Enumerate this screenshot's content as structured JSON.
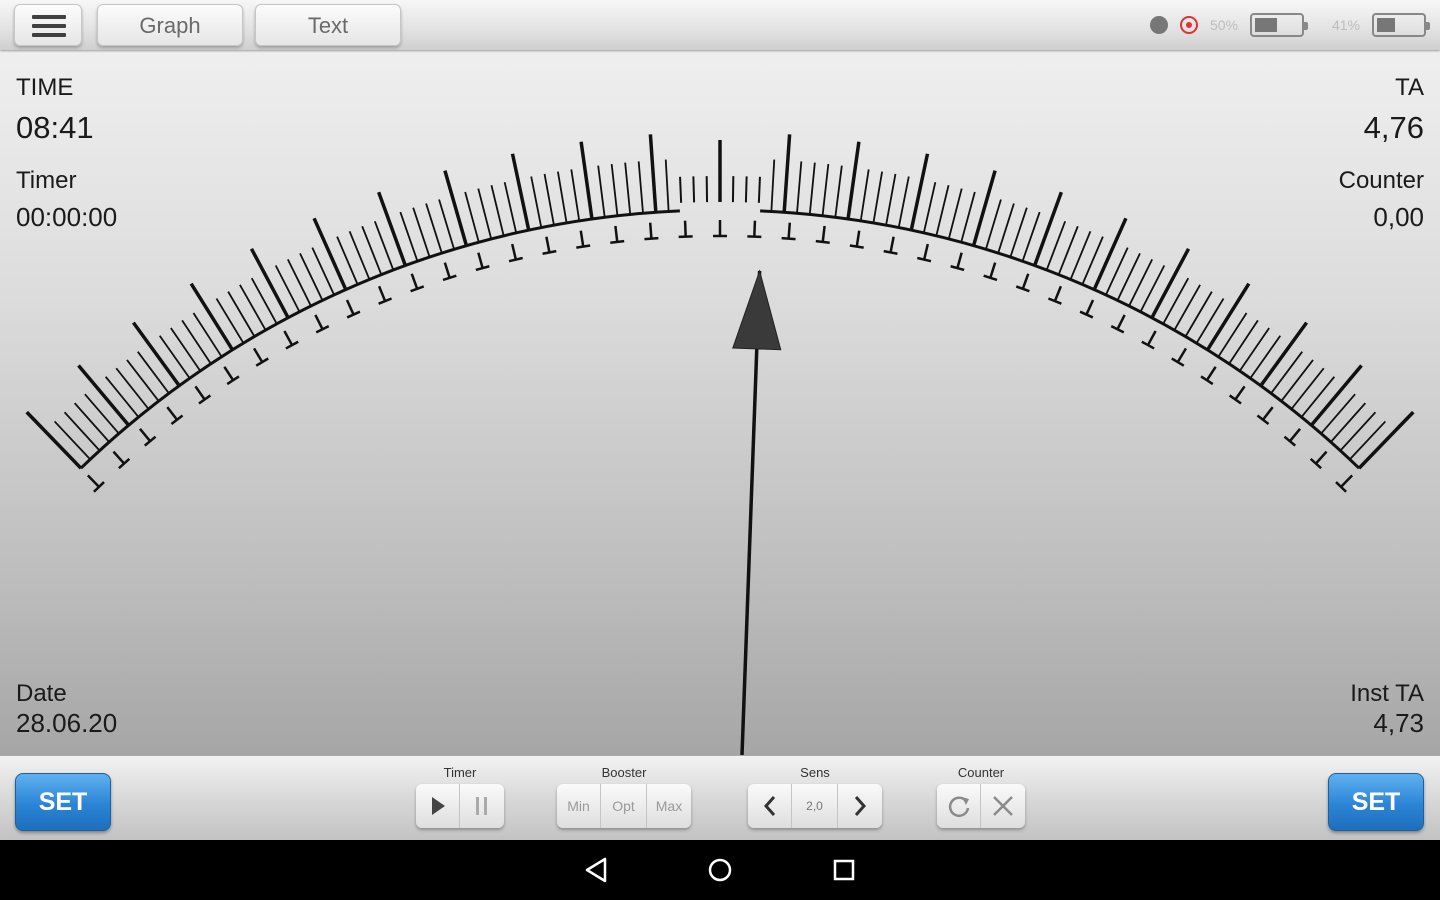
{
  "topbar": {
    "graph_label": "Graph",
    "text_label": "Text",
    "battery1_percent": "50%",
    "battery1_level": 0.5,
    "battery2_percent": "41%",
    "battery2_level": 0.41
  },
  "readouts": {
    "time_label": "TIME",
    "time_value": "08:41",
    "timer_label": "Timer",
    "timer_value": "00:00:00",
    "date_label": "Date",
    "date_value": "28.06.20",
    "ta_label": "TA",
    "ta_value": "4,76",
    "counter_label": "Counter",
    "counter_value": "0,00",
    "inst_ta_label": "Inst TA",
    "inst_ta_value": "4,73"
  },
  "meter": {
    "needle_fraction": 0.53
  },
  "controls": {
    "set_left": "SET",
    "set_right": "SET",
    "timer_title": "Timer",
    "booster_title": "Booster",
    "booster_min": "Min",
    "booster_opt": "Opt",
    "booster_max": "Max",
    "sens_title": "Sens",
    "sens_value": "2,0",
    "counter_title": "Counter"
  },
  "colors": {
    "set_button": "#2b84d6",
    "record_indicator": "#d33333"
  }
}
